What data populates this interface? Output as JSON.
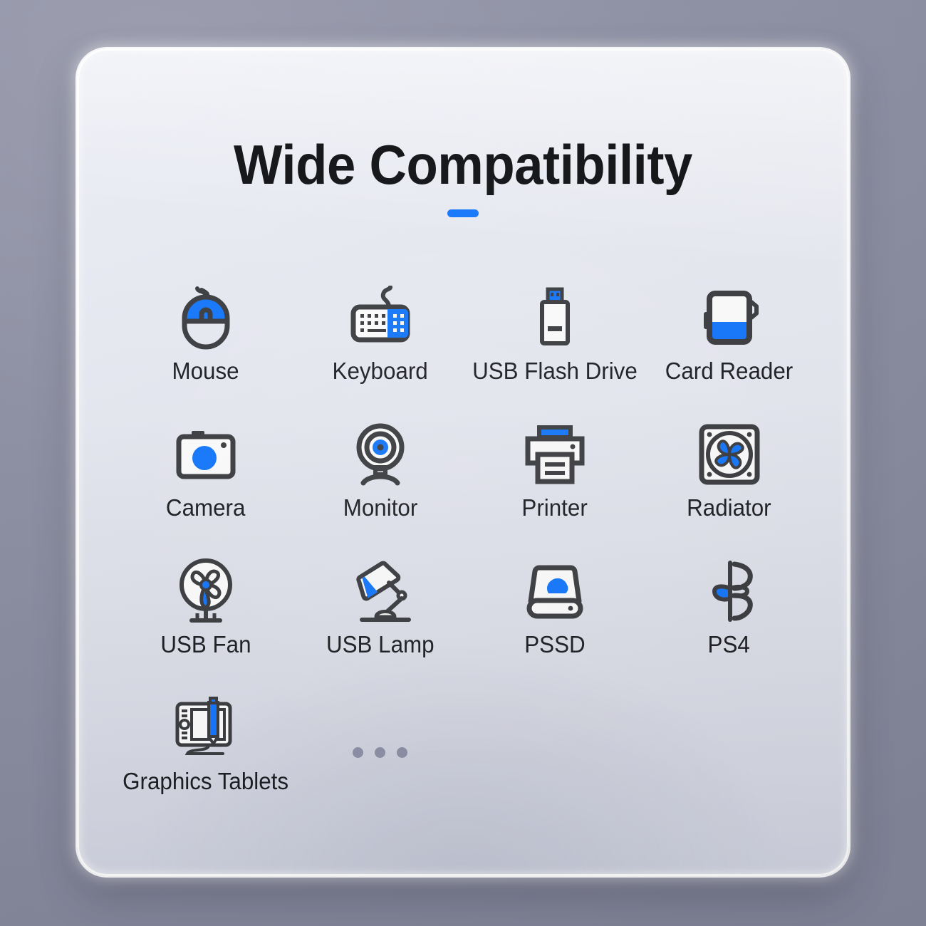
{
  "card": {
    "title": "Wide Compatibility",
    "accent_color": "#1277ff",
    "stroke_color": "#3b3c40",
    "background_color": "#e9ebf4",
    "page_background_color": "#8d8fa3"
  },
  "items": [
    {
      "label": "Mouse",
      "icon": "mouse-icon"
    },
    {
      "label": "Keyboard",
      "icon": "keyboard-icon"
    },
    {
      "label": "USB Flash Drive",
      "icon": "usb-flash-drive-icon"
    },
    {
      "label": "Card Reader",
      "icon": "card-reader-icon"
    },
    {
      "label": "Camera",
      "icon": "camera-icon"
    },
    {
      "label": "Monitor",
      "icon": "webcam-icon"
    },
    {
      "label": "Printer",
      "icon": "printer-icon"
    },
    {
      "label": "Radiator",
      "icon": "radiator-fan-icon"
    },
    {
      "label": "USB Fan",
      "icon": "usb-fan-icon"
    },
    {
      "label": "USB Lamp",
      "icon": "usb-lamp-icon"
    },
    {
      "label": "PSSD",
      "icon": "portable-ssd-icon"
    },
    {
      "label": "PS4",
      "icon": "playstation-icon"
    },
    {
      "label": "Graphics Tablets",
      "icon": "graphics-tablet-icon"
    }
  ],
  "more_indicator": {
    "name": "more-items-dots",
    "count": 3
  }
}
